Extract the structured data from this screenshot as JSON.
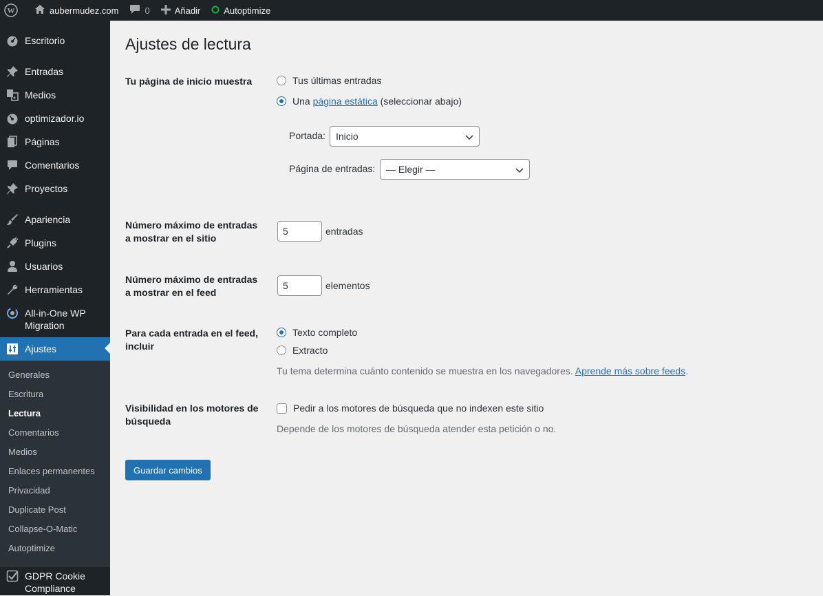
{
  "adminbar": {
    "site_name": "aubermudez.com",
    "comments_count": "0",
    "add_new_label": "Añadir",
    "autoptimize_label": "Autoptimize",
    "status_color": "#00ba37"
  },
  "sidebar": {
    "items": [
      {
        "label": "Escritorio",
        "icon": "dashboard-icon"
      },
      {
        "label": "Entradas",
        "icon": "pin-icon"
      },
      {
        "label": "Medios",
        "icon": "media-icon"
      },
      {
        "label": "optimizador.io",
        "icon": "gauge-icon"
      },
      {
        "label": "Páginas",
        "icon": "pages-icon"
      },
      {
        "label": "Comentarios",
        "icon": "comment-icon"
      },
      {
        "label": "Proyectos",
        "icon": "pin-icon"
      },
      {
        "label": "Apariencia",
        "icon": "brush-icon"
      },
      {
        "label": "Plugins",
        "icon": "plug-icon"
      },
      {
        "label": "Usuarios",
        "icon": "user-icon"
      },
      {
        "label": "Herramientas",
        "icon": "wrench-icon"
      },
      {
        "label": "All-in-One WP Migration",
        "icon": "migration-icon"
      },
      {
        "label": "Ajustes",
        "icon": "settings-icon"
      },
      {
        "label": "GDPR Cookie Compliance",
        "icon": "check-icon"
      }
    ],
    "submenu": [
      "Generales",
      "Escritura",
      "Lectura",
      "Comentarios",
      "Medios",
      "Enlaces permanentes",
      "Privacidad",
      "Duplicate Post",
      "Collapse-O-Matic",
      "Autoptimize"
    ],
    "current_submenu": "Lectura"
  },
  "page": {
    "title": "Ajustes de lectura",
    "front_page": {
      "label": "Tu página de inicio muestra",
      "option_latest": "Tus últimas entradas",
      "option_static_prefix": "Una",
      "option_static_link": "página estática",
      "option_static_suffix": "(seleccionar abajo)",
      "selected": "static",
      "portada_label": "Portada:",
      "portada_value": "Inicio",
      "posts_page_label": "Página de entradas:",
      "posts_page_value": "— Elegir —"
    },
    "posts_per_page": {
      "label_line1": "Número máximo de entradas",
      "label_line2": "a mostrar en el sitio",
      "value": "5",
      "unit": "entradas"
    },
    "feed_items": {
      "label_line1": "Número máximo de entradas",
      "label_line2": "a mostrar en el feed",
      "value": "5",
      "unit": "elementos"
    },
    "feed_content": {
      "label_line1": "Para cada entrada en el feed,",
      "label_line2": "incluir",
      "option_full": "Texto completo",
      "option_excerpt": "Extracto",
      "selected": "full",
      "description": "Tu tema determina cuánto contenido se muestra en los navegadores.",
      "link": "Aprende más sobre feeds",
      "link_suffix": "."
    },
    "search_visibility": {
      "label_line1": "Visibilidad en los motores de",
      "label_line2": "búsqueda",
      "checkbox_label": "Pedir a los motores de búsqueda que no indexen este sitio",
      "checked": false,
      "description": "Depende de los motores de búsqueda atender esta petición o no."
    },
    "save_button": "Guardar cambios"
  },
  "colors": {
    "adminbar_bg": "#1d2327",
    "accent": "#2271b1",
    "page_bg": "#f0f0f1"
  }
}
